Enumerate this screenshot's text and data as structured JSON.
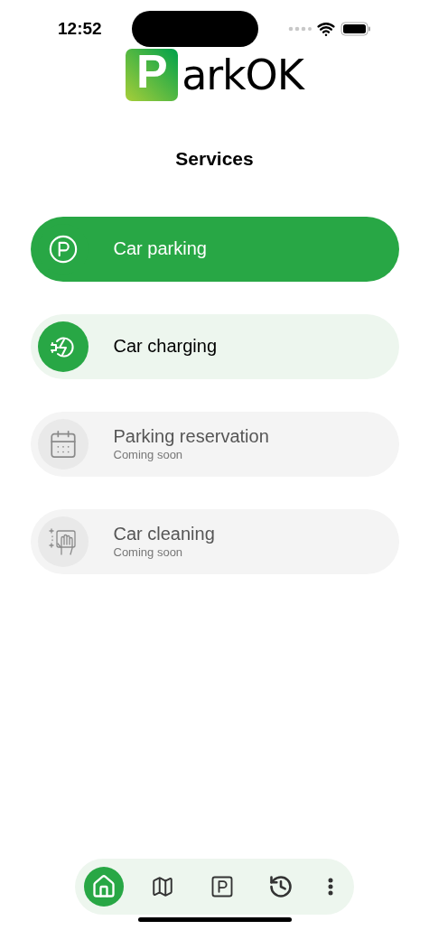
{
  "status_bar": {
    "time": "12:52"
  },
  "logo": {
    "badge_letter": "P",
    "text": "arkOK"
  },
  "title": "Services",
  "services": [
    {
      "kind": "parking",
      "label": "Car parking",
      "selected": true,
      "disabled": false
    },
    {
      "kind": "charging",
      "label": "Car charging",
      "selected": false,
      "disabled": false
    },
    {
      "kind": "calendar",
      "label": "Parking reservation",
      "note": "Coming soon",
      "selected": false,
      "disabled": true
    },
    {
      "kind": "cleaning",
      "label": "Car cleaning",
      "note": "Coming soon",
      "selected": false,
      "disabled": true
    }
  ],
  "nav": [
    {
      "kind": "home",
      "selected": true
    },
    {
      "kind": "map",
      "selected": false
    },
    {
      "kind": "parking",
      "selected": false
    },
    {
      "kind": "history",
      "selected": false
    },
    {
      "kind": "more",
      "selected": false
    }
  ]
}
